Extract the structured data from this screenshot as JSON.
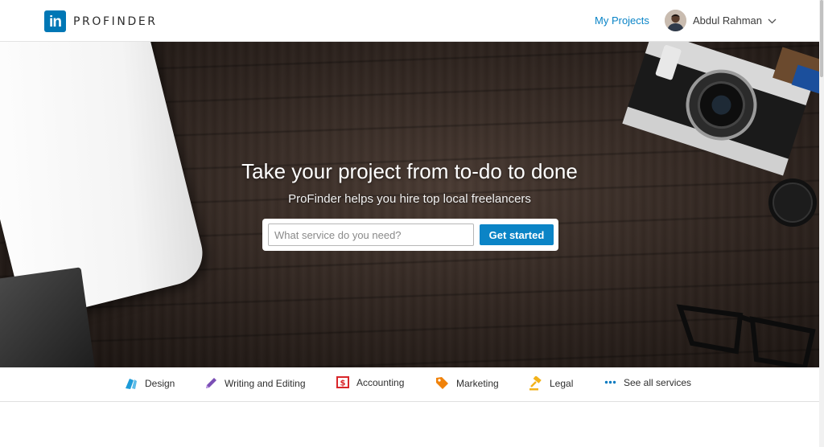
{
  "header": {
    "logo_letters": "in",
    "logo_text": "PROFINDER",
    "my_projects": "My Projects",
    "user_name": "Abdul Rahman"
  },
  "hero": {
    "title": "Take your project from to-do to done",
    "subtitle": "ProFinder helps you hire top local freelancers",
    "search_placeholder": "What service do you need?",
    "search_value": "",
    "cta_label": "Get started"
  },
  "categories": [
    {
      "label": "Design",
      "icon": "design-icon",
      "color": "#1d9bd8"
    },
    {
      "label": "Writing and Editing",
      "icon": "pencil-icon",
      "color": "#7b4fb5"
    },
    {
      "label": "Accounting",
      "icon": "dollar-icon",
      "color": "#d9262a"
    },
    {
      "label": "Marketing",
      "icon": "tag-icon",
      "color": "#f0820a"
    },
    {
      "label": "Legal",
      "icon": "gavel-icon",
      "color": "#f2b21a"
    },
    {
      "label": "See all services",
      "icon": "ellipsis-icon",
      "color": "#0a7ac0"
    }
  ],
  "colors": {
    "brand": "#0077b5",
    "link": "#0a84c7",
    "cta": "#0b84c6"
  }
}
